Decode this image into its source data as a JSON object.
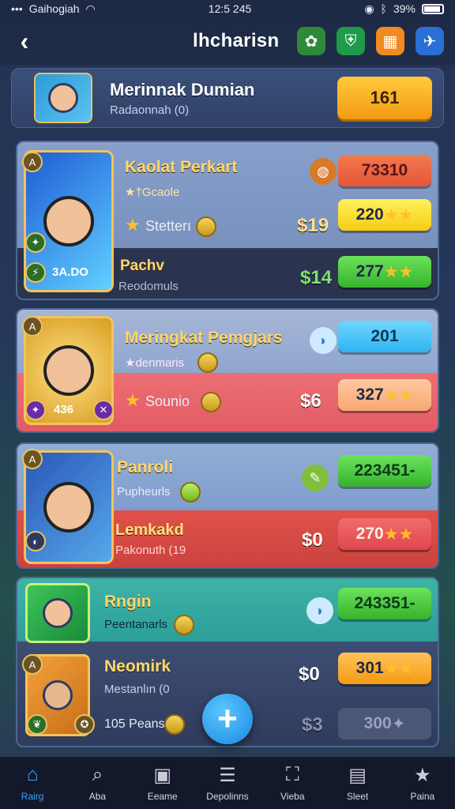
{
  "status_bar": {
    "carrier": "Gaihogiah",
    "time": "12:5 245",
    "battery": "39%"
  },
  "header": {
    "title": "lhcharisn"
  },
  "profile": {
    "name": "Merinnak Dumian",
    "subtitle": "Radaonnah (0)",
    "value": "161"
  },
  "cards": [
    {
      "name": "Kaolat Perkart",
      "tag": "★†Gcaole",
      "feature": "Stetterı",
      "price1": "$19",
      "btn_top": "73310",
      "btn_mid": "220",
      "sub_name": "Pachv",
      "sub_sub": "Reodomuls",
      "price2": "$14",
      "btn_bot": "277",
      "badge": "3A.DO"
    },
    {
      "name": "Meringkat Pemgjars",
      "tag": "★denmaris",
      "feature": "Sounio",
      "price1": "$6",
      "btn_top": "201",
      "btn_mid": "327",
      "badge": "436"
    },
    {
      "name": "Panroli",
      "tag": "Pupheurls",
      "price1": "$0",
      "btn_top": "223451-",
      "btn_mid": "270",
      "sub_name": "Lemkakd",
      "sub_sub": "Pakonuth (19"
    },
    {
      "name": "Rngin",
      "tag": "Peentanarls",
      "price1": "$0",
      "btn_top": "243351-",
      "btn_mid": "301",
      "sub_name": "Neomirk",
      "sub_sub": "Mestanlın (0",
      "footer_text": "105 Peans",
      "price2": "$3",
      "btn_bot": "300"
    }
  ],
  "tabs": [
    "Rairg",
    "Aba",
    "Eeame",
    "Depolinns",
    "Vieba",
    "Sleet",
    "Paina"
  ],
  "colors": {
    "orange": "#f39b12",
    "green": "#3cc23c",
    "blue": "#3ab7f3",
    "red": "#e8474a",
    "yellow": "#ffd33d",
    "peach": "#f8b27a"
  }
}
